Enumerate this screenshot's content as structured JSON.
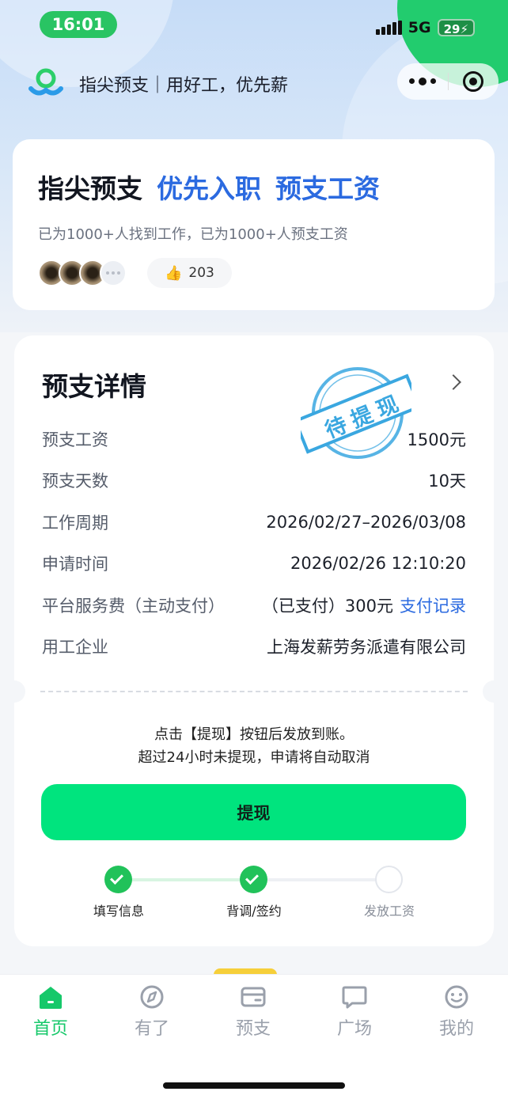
{
  "status_bar": {
    "time": "16:01",
    "network": "5G",
    "battery": "29"
  },
  "header": {
    "title": "指尖预支｜用好工，优先薪"
  },
  "intro": {
    "brand": "指尖预支",
    "highlight_1": "优先入职",
    "highlight_2": "预支工资",
    "subtitle": "已为1000+人找到工作，已为1000+人预支工资",
    "like_count": "203"
  },
  "detail": {
    "title": "预支详情",
    "stamp": "待提现",
    "rows": [
      {
        "label": "预支工资",
        "value": "1500元"
      },
      {
        "label": "预支天数",
        "value": "10天"
      },
      {
        "label": "工作周期",
        "value": "2026/02/27–2026/03/08"
      },
      {
        "label": "申请时间",
        "value": "2026/02/26 12:10:20"
      },
      {
        "label": "平台服务费（主动支付）",
        "value": "（已支付）300元",
        "link": "支付记录"
      },
      {
        "label": "用工企业",
        "value": "上海发薪劳务派遣有限公司"
      }
    ],
    "notice_line1": "点击【提现】按钮后发放到账。",
    "notice_line2": "超过24小时未提现，申请将自动取消",
    "button": "提现",
    "steps": [
      {
        "label": "填写信息",
        "status": "done"
      },
      {
        "label": "背调/签约",
        "status": "done"
      },
      {
        "label": "发放工资",
        "status": "todo"
      }
    ]
  },
  "tabbar": {
    "items": [
      {
        "label": "首页",
        "icon": "home-icon",
        "active": true
      },
      {
        "label": "有了",
        "icon": "compass-icon",
        "active": false
      },
      {
        "label": "预支",
        "icon": "wallet-icon",
        "active": false
      },
      {
        "label": "广场",
        "icon": "chat-icon",
        "active": false
      },
      {
        "label": "我的",
        "icon": "smile-icon",
        "active": false
      }
    ]
  },
  "colors": {
    "accent_green": "#00e47e",
    "link_blue": "#2b6ae0",
    "stamp_blue": "#3aa7e0"
  }
}
